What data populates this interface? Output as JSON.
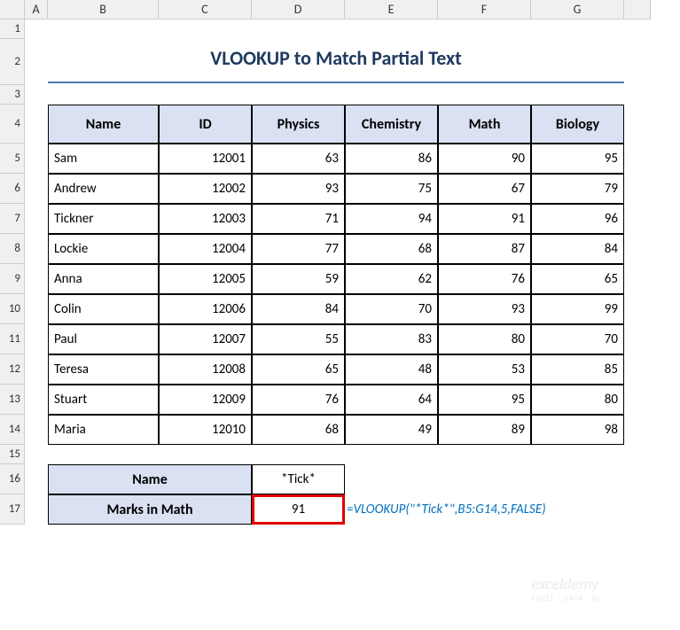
{
  "columns": [
    "A",
    "B",
    "C",
    "D",
    "E",
    "F",
    "G"
  ],
  "rows": [
    "1",
    "2",
    "3",
    "4",
    "5",
    "6",
    "7",
    "8",
    "9",
    "10",
    "11",
    "12",
    "13",
    "14",
    "15",
    "16",
    "17"
  ],
  "title": "VLOOKUP to Match Partial Text",
  "headers": [
    "Name",
    "ID",
    "Physics",
    "Chemistry",
    "Math",
    "Biology"
  ],
  "data": [
    {
      "name": "Sam",
      "id": "12001",
      "physics": "63",
      "chemistry": "86",
      "math": "90",
      "biology": "95"
    },
    {
      "name": "Andrew",
      "id": "12002",
      "physics": "93",
      "chemistry": "75",
      "math": "67",
      "biology": "79"
    },
    {
      "name": "Tickner",
      "id": "12003",
      "physics": "71",
      "chemistry": "94",
      "math": "91",
      "biology": "96"
    },
    {
      "name": "Lockie",
      "id": "12004",
      "physics": "77",
      "chemistry": "68",
      "math": "87",
      "biology": "84"
    },
    {
      "name": "Anna",
      "id": "12005",
      "physics": "59",
      "chemistry": "62",
      "math": "76",
      "biology": "65"
    },
    {
      "name": "Colin",
      "id": "12006",
      "physics": "84",
      "chemistry": "70",
      "math": "93",
      "biology": "99"
    },
    {
      "name": "Paul",
      "id": "12007",
      "physics": "55",
      "chemistry": "83",
      "math": "80",
      "biology": "70"
    },
    {
      "name": "Teresa",
      "id": "12008",
      "physics": "65",
      "chemistry": "48",
      "math": "53",
      "biology": "85"
    },
    {
      "name": "Stuart",
      "id": "12009",
      "physics": "76",
      "chemistry": "64",
      "math": "95",
      "biology": "80"
    },
    {
      "name": "Maria",
      "id": "12010",
      "physics": "68",
      "chemistry": "49",
      "math": "89",
      "biology": "98"
    }
  ],
  "lookup": {
    "name_label": "Name",
    "name_value": "*Tick*",
    "marks_label": "Marks in Math",
    "marks_value": "91",
    "formula": "=VLOOKUP(\"*Tick*\",B5:G14,5,FALSE)"
  },
  "watermark": {
    "main": "exceldemy",
    "sub": "EXCEL · DATA · BI"
  }
}
